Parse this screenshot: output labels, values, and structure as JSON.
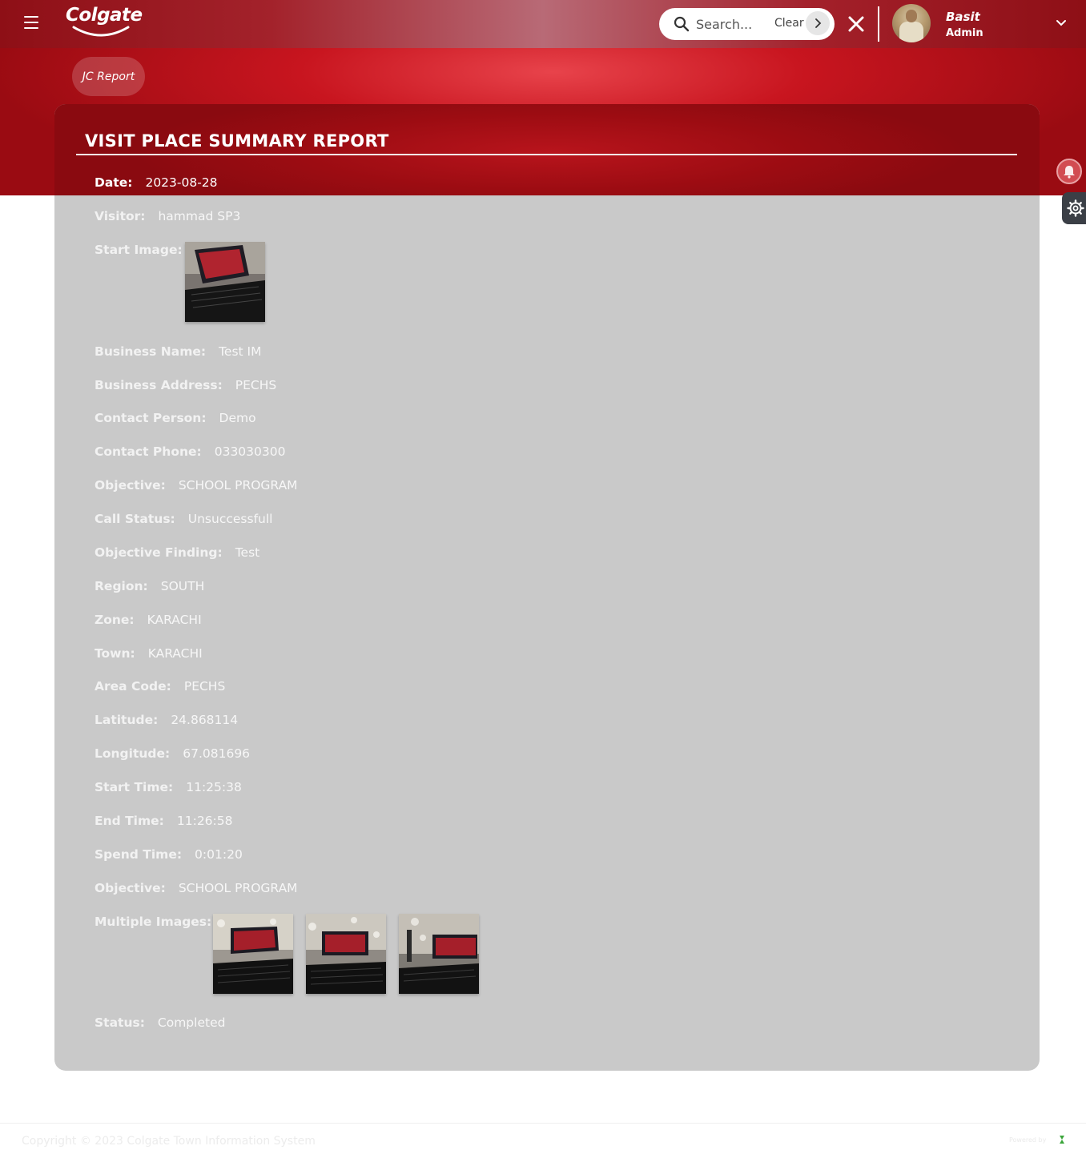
{
  "header": {
    "brand": "Colgate",
    "search_placeholder": "Search...",
    "clear_label": "Clear",
    "user": {
      "name": "Basit",
      "role": "Admin"
    }
  },
  "breadcrumb": {
    "label": "JC Report"
  },
  "report": {
    "title": "VISIT PLACE SUMMARY REPORT",
    "date": {
      "label": "Date:",
      "value": "2023-08-28"
    },
    "visitor": {
      "label": "Visitor:",
      "value": "hammad SP3"
    },
    "start_image": {
      "label": "Start Image:"
    },
    "fields": [
      {
        "label": "Business Name:",
        "value": "Test IM"
      },
      {
        "label": "Business Address:",
        "value": "PECHS"
      },
      {
        "label": "Contact Person:",
        "value": "Demo"
      },
      {
        "label": "Contact Phone:",
        "value": "033030300"
      },
      {
        "label": "Objective:",
        "value": "SCHOOL PROGRAM"
      },
      {
        "label": "Call Status:",
        "value": "Unsuccessfull"
      },
      {
        "label": "Objective Finding:",
        "value": "Test"
      },
      {
        "label": "Region:",
        "value": "SOUTH"
      },
      {
        "label": "Zone:",
        "value": "KARACHI"
      },
      {
        "label": "Town:",
        "value": "KARACHI"
      },
      {
        "label": "Area Code:",
        "value": "PECHS"
      },
      {
        "label": "Latitude:",
        "value": "24.868114"
      },
      {
        "label": "Longitude:",
        "value": "67.081696"
      },
      {
        "label": "Start Time:",
        "value": "11:25:38"
      },
      {
        "label": "End Time:",
        "value": "11:26:58"
      },
      {
        "label": "Spend Time:",
        "value": "0:01:20"
      },
      {
        "label": "Objective:",
        "value": "SCHOOL PROGRAM"
      }
    ],
    "multiple_images": {
      "label": "Multiple Images:"
    },
    "status": {
      "label": "Status:",
      "value": "Completed"
    }
  },
  "footer": {
    "copyright": "Copyright © 2023 Colgate Town Information System",
    "powered_by": "Powered by"
  },
  "icons": {
    "menu": "hamburger-menu-icon",
    "search": "search-icon",
    "go": "chevron-right-icon",
    "close": "close-icon",
    "dropdown": "chevron-down-icon",
    "notifications": "bell-icon",
    "settings": "gear-icon"
  },
  "colors": {
    "brand_red": "#c8151f",
    "header_dark_red": "#8e0f16",
    "card_gray": "#c9c9c9",
    "settings_dark": "#3b3f46"
  }
}
